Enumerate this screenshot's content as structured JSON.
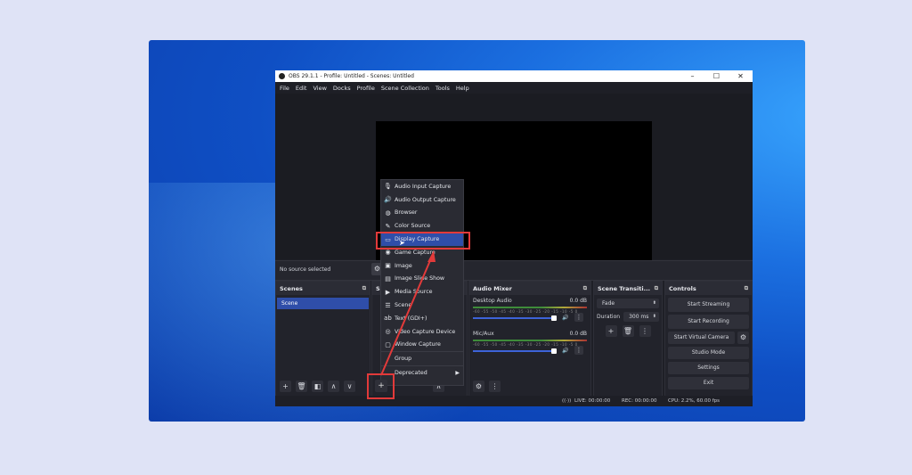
{
  "window": {
    "title": "OBS 29.1.1 - Profile: Untitled - Scenes: Untitled",
    "controls": [
      "–",
      "☐",
      "✕"
    ]
  },
  "menubar": [
    "File",
    "Edit",
    "View",
    "Docks",
    "Profile",
    "Scene Collection",
    "Tools",
    "Help"
  ],
  "source_bar": {
    "status": "No source selected"
  },
  "scenes": {
    "title": "Scenes",
    "items": [
      "Scene"
    ]
  },
  "sources": {
    "title": "S"
  },
  "audio_mixer": {
    "title": "Audio Mixer",
    "channels": [
      {
        "name": "Desktop Audio",
        "level": "0.0 dB"
      },
      {
        "name": "Mic/Aux",
        "level": "0.0 dB"
      }
    ],
    "scale": "-60 -55 -50 -45 -40 -35 -30 -25 -20 -15 -10 -5 0"
  },
  "transitions": {
    "title": "Scene Transiti...",
    "type": "Fade",
    "duration_label": "Duration",
    "duration_value": "300 ms"
  },
  "controls": {
    "title": "Controls",
    "buttons": [
      "Start Streaming",
      "Start Recording",
      "Start Virtual Camera",
      "Studio Mode",
      "Settings",
      "Exit"
    ]
  },
  "status": {
    "live": "LIVE: 00:00:00",
    "rec": "REC: 00:00:00",
    "cpu": "CPU: 2.2%, 60.00 fps"
  },
  "add_source_menu": {
    "items": [
      {
        "label": "Audio Input Capture",
        "icon": "microphone-icon"
      },
      {
        "label": "Audio Output Capture",
        "icon": "speaker-icon"
      },
      {
        "label": "Browser",
        "icon": "globe-icon"
      },
      {
        "label": "Color Source",
        "icon": "brush-icon"
      },
      {
        "label": "Display Capture",
        "icon": "monitor-icon"
      },
      {
        "label": "Game Capture",
        "icon": "gamepad-icon"
      },
      {
        "label": "Image",
        "icon": "image-icon"
      },
      {
        "label": "Image Slide Show",
        "icon": "slideshow-icon"
      },
      {
        "label": "Media Source",
        "icon": "play-icon"
      },
      {
        "label": "Scene",
        "icon": "list-icon"
      },
      {
        "label": "Text (GDI+)",
        "icon": "text-icon"
      },
      {
        "label": "Video Capture Device",
        "icon": "camera-icon"
      },
      {
        "label": "Window Capture",
        "icon": "window-icon"
      },
      {
        "label": "Group",
        "icon": "folder-icon"
      },
      {
        "label": "Deprecated",
        "icon": ""
      }
    ]
  },
  "colors": {
    "highlight": "#e23a3a",
    "accent": "#2f4ea9"
  }
}
